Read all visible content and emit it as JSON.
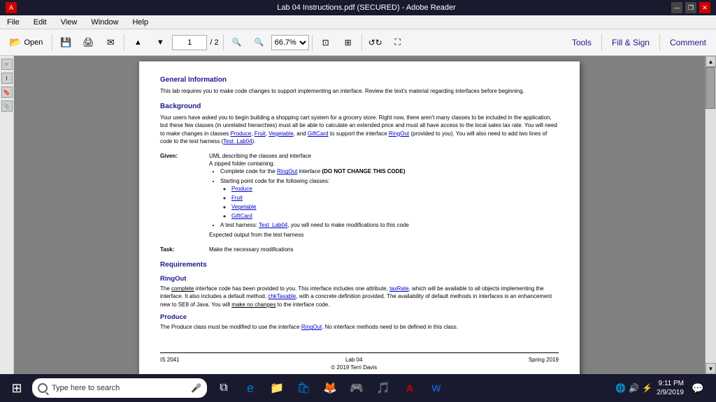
{
  "titleBar": {
    "title": "Lab 04 Instructions.pdf (SECURED) - Adobe Reader",
    "controls": [
      "minimize",
      "restore",
      "close"
    ]
  },
  "menuBar": {
    "items": [
      "File",
      "Edit",
      "View",
      "Window",
      "Help"
    ]
  },
  "toolbar": {
    "openLabel": "Open",
    "pageInput": "1",
    "pageTotal": "/ 2",
    "zoomValue": "66.7%",
    "rightButtons": [
      "Tools",
      "Fill & Sign",
      "Comment"
    ]
  },
  "pdf": {
    "generalInfoTitle": "General Information",
    "generalInfoText": "This lab requires you to make code changes to support implementing an interface.  Review the text's material regarding interfaces before beginning.",
    "backgroundTitle": "Background",
    "backgroundText1": "Your users have asked you to begin building a shopping cart system for a grocery store.  Right now, there aren't many classes to be included in the application, but these few classes (in unrelated hierarchies) must all be able to calculate an extended price and must all have access to the local sales tax rate.  You will need to make changes in classes ",
    "backgroundLink1": "Produce",
    "backgroundText2": ", ",
    "backgroundLink2": "Fruit",
    "backgroundText3": ", ",
    "backgroundLink3": "Vegetable",
    "backgroundText4": ", and ",
    "backgroundLink4": "GiftCard",
    "backgroundText5": " to support the interface ",
    "backgroundLink5": "RingOut",
    "backgroundText6": " (provided to you).  You will also need to add two lines of code to the test harness (",
    "backgroundLink6": "Test_Lab04",
    "backgroundText7": ").",
    "givenLabel": "Given:",
    "givenContent1": "UML describing the classes and interface",
    "givenContent2": "A zipped folder containing:",
    "givenBullet1": "Complete code for the ",
    "givenBulletLink1": "RingOut",
    "givenBullet1b": " interface ",
    "givenBullet1Bold": "(DO NOT CHANGE THIS CODE)",
    "givenBullet2": "Starting point code for the following classes:",
    "givenSubItems": [
      "Produce",
      "Fruit",
      "Vegetable",
      "GiftCard"
    ],
    "givenBullet3": "A test harness: ",
    "givenBulletLink3": "Test_Lab04",
    "givenBullet3b": ", you will need to make modifications to this code",
    "givenContent3": "Expected output from the test harness",
    "taskLabel": "Task:",
    "taskContent": "Make the necessary modifications",
    "requirementsTitle": "Requirements",
    "ringOutTitle": "RingOut",
    "ringOutText1": "The ",
    "ringOutUnderline": "complete",
    "ringOutText2": " interface code has been provided to you.  This interface includes one attribute, ",
    "ringOutLink1": "taxRate",
    "ringOutText3": ", which will be available to all objects implementing the interface.  It also includes a default method, ",
    "ringOutLink2": "chkTaxable",
    "ringOutText4": ", with a concrete definition provided.  The availability of default methods in interfaces is an enhancement new to SE8 of Java.  You will ",
    "ringOutUnderline2": "make no changes",
    "ringOutText5": " to the interface code.",
    "produceTitle": "Produce",
    "produceText1": "The Produce class must be modified to use the interface ",
    "produceLink1": "RingOut",
    "produceText2": ".  No interface methods need to be defined in this class.",
    "footerLeft": "IS 2041",
    "footerCenter": "Lab 04\n© 2019 Terri Davis",
    "footerRight": "Spring 2019"
  },
  "taskbar": {
    "searchPlaceholder": "Type here to search",
    "time": "9:11 PM",
    "date": "2/9/2019",
    "icons": [
      "⊞",
      "🔲",
      "◎",
      "e",
      "📁",
      "🛒",
      "🦊",
      "🎮",
      "🎵",
      "🔴",
      "🎯",
      "🔧"
    ]
  }
}
